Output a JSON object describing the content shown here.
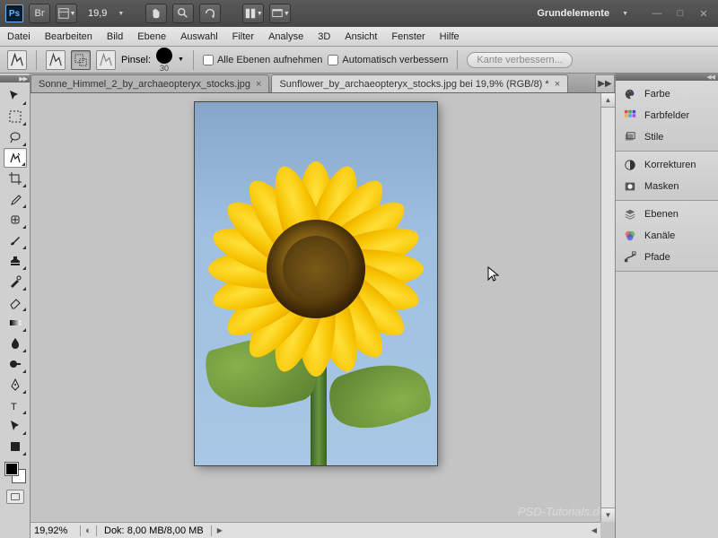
{
  "app": {
    "zoom_display": "19,9",
    "workspace": "Grundelemente"
  },
  "menu": {
    "items": [
      "Datei",
      "Bearbeiten",
      "Bild",
      "Ebene",
      "Auswahl",
      "Filter",
      "Analyse",
      "3D",
      "Ansicht",
      "Fenster",
      "Hilfe"
    ]
  },
  "options": {
    "pinsel_label": "Pinsel:",
    "pinsel_size": "30",
    "all_layers": "Alle Ebenen aufnehmen",
    "auto_enhance": "Automatisch verbessern",
    "refine_edge": "Kante verbessern..."
  },
  "tabs": [
    {
      "title": "Sonne_Himmel_2_by_archaeopteryx_stocks.jpg",
      "active": false
    },
    {
      "title": "Sunflower_by_archaeopteryx_stocks.jpg bei 19,9% (RGB/8) *",
      "active": true
    }
  ],
  "status": {
    "zoom": "19,92%",
    "docsize_label": "Dok:",
    "docsize": "8,00 MB/8,00 MB"
  },
  "panels": {
    "group1": [
      "Farbe",
      "Farbfelder",
      "Stile"
    ],
    "group2": [
      "Korrekturen",
      "Masken"
    ],
    "group3": [
      "Ebenen",
      "Kanäle",
      "Pfade"
    ]
  },
  "watermark": "PSD-Tutorials.de"
}
